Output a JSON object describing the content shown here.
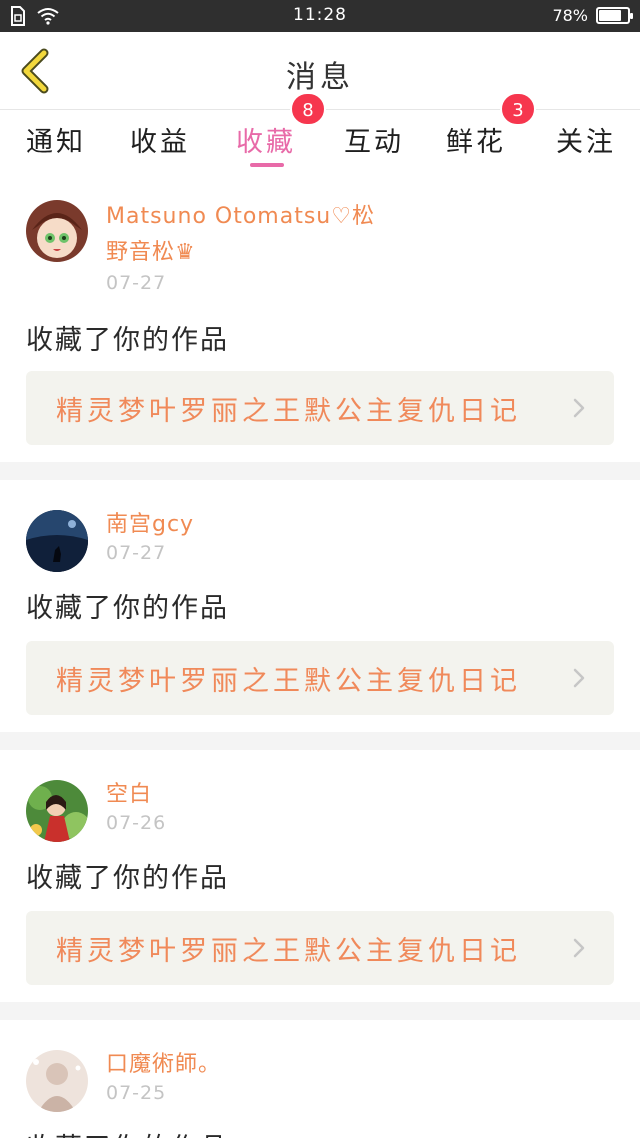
{
  "status_bar": {
    "time": "11:28",
    "battery": "78%",
    "battery_level": 0.78
  },
  "header": {
    "title": "消息",
    "back_icon": "chevron-left-icon"
  },
  "tabs": [
    {
      "label": "通知"
    },
    {
      "label": "收益"
    },
    {
      "label": "收藏",
      "badge": "8",
      "active": true
    },
    {
      "label": "互动"
    },
    {
      "label": "鲜花",
      "badge": "3"
    },
    {
      "label": "关注"
    }
  ],
  "notifications": [
    {
      "user_line1": "Matsuno Otomatsu♡松",
      "user_line2": "野音松",
      "crown": "♛",
      "date": "07-27",
      "action": "收藏了你的作品",
      "work": "精灵梦叶罗丽之王默公主复仇日记"
    },
    {
      "user_line1": "南宫gcy",
      "date": "07-27",
      "action": "收藏了你的作品",
      "work": "精灵梦叶罗丽之王默公主复仇日记"
    },
    {
      "user_line1": "空白",
      "date": "07-26",
      "action": "收藏了你的作品",
      "work": "精灵梦叶罗丽之王默公主复仇日记"
    },
    {
      "user_line1": "口魔術師。",
      "date": "07-25",
      "action": "收藏了你的作品"
    }
  ],
  "colors": {
    "accent_pink": "#e86aa8",
    "username_orange": "#f08a52",
    "badge_red": "#f6364e",
    "back_yellow": "#f2d83c"
  }
}
